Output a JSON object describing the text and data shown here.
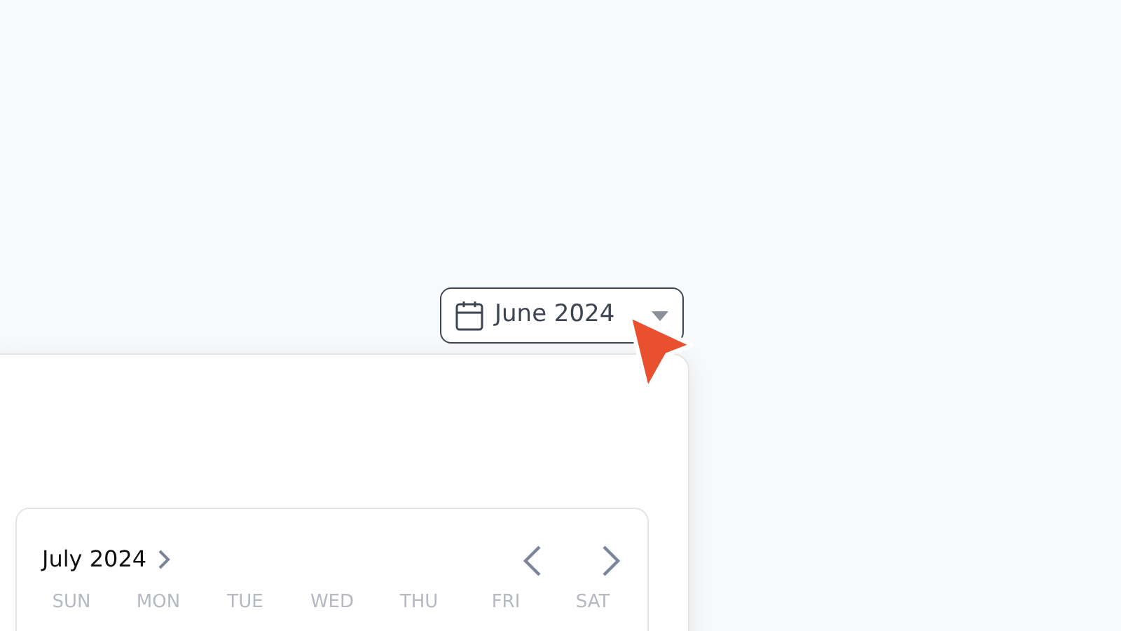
{
  "month_button": {
    "label": "June 2024"
  },
  "calendar": {
    "month_label": "July 2024",
    "weekdays": [
      "SUN",
      "MON",
      "TUE",
      "WED",
      "THU",
      "FRI",
      "SAT"
    ]
  }
}
